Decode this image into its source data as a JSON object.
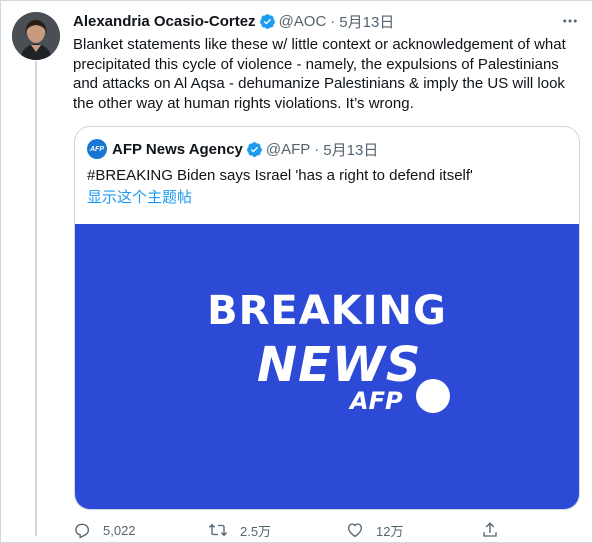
{
  "tweet": {
    "author_name": "Alexandria Ocasio-Cortez",
    "handle": "@AOC",
    "separator": "·",
    "date": "5月13日",
    "text": "Blanket statements like these w/ little context or acknowledgement of what\nprecipitated this cycle of violence - namely, the expulsions of Palestinians\nand attacks on Al Aqsa - dehumanize Palestinians & imply the US will look\nthe other way at human rights violations. It’s wrong."
  },
  "quoted_tweet": {
    "avatar_text": "AFP",
    "author_name": "AFP News Agency",
    "handle": "@AFP",
    "separator": "·",
    "date": "5月13日",
    "text": "#BREAKING Biden says Israel 'has a right to defend itself'",
    "show_thread_link": "显示这个主题帖",
    "media": {
      "line1": "BREAKING",
      "line2": "NEWS",
      "brand": "AFP"
    }
  },
  "actions": {
    "reply_count": "5,022",
    "retweet_count": "2.5万",
    "like_count": "12万"
  },
  "colors": {
    "verified": "#1d9bf0",
    "link": "#1d9bf0",
    "media_bg": "#2c4ad6",
    "muted_text": "#536471",
    "icon": "#536471"
  },
  "icons": [
    "more-icon",
    "verified-icon",
    "reply-icon",
    "retweet-icon",
    "like-icon",
    "share-icon"
  ]
}
